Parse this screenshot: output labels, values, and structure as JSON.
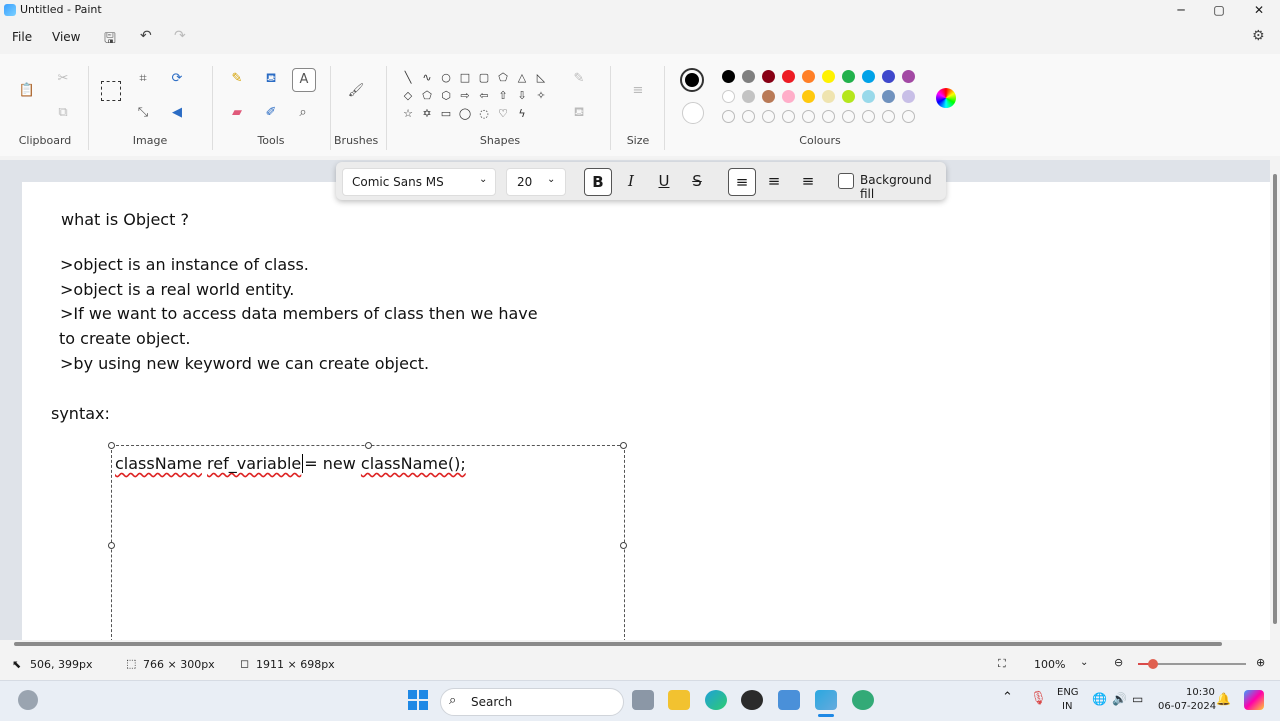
{
  "window": {
    "title": "Untitled - Paint",
    "min": "─",
    "max": "▢",
    "close": "✕"
  },
  "menu": {
    "file": "File",
    "view": "View"
  },
  "ribbon": {
    "groups": {
      "clipboard": "Clipboard",
      "image": "Image",
      "tools": "Tools",
      "brushes": "Brushes",
      "shapes": "Shapes",
      "size": "Size",
      "colours": "Colours"
    }
  },
  "colors": {
    "row1": [
      "#000000",
      "#7f7f7f",
      "#880015",
      "#ed1c24",
      "#ff7f27",
      "#fff200",
      "#22b14c",
      "#00a2e8",
      "#3f48cc",
      "#a349a4"
    ],
    "row2": [
      "#ffffff",
      "#c3c3c3",
      "#b97a57",
      "#ffaec9",
      "#ffc90e",
      "#efe4b0",
      "#b5e61d",
      "#99d9ea",
      "#7092be",
      "#c8bfe7"
    ],
    "primary": "#000000",
    "secondary": "#ffffff"
  },
  "text_toolbar": {
    "font": "Comic Sans MS",
    "size": "20",
    "bold": "B",
    "italic": "I",
    "underline": "U",
    "strike": "S",
    "background_fill": "Background fill"
  },
  "canvas": {
    "heading": "what is Object ?",
    "lines": [
      ">object is an instance of class.",
      ">object is a real world entity.",
      ">If we want to access data members of class then we have",
      "to create object.",
      ">by using new keyword we can create object."
    ],
    "syntax_label": "syntax:",
    "code": {
      "p1": "className",
      "p2": "ref_variable",
      "p3": "= new",
      "p4": "className();"
    }
  },
  "status": {
    "cursor": "506, 399px",
    "selection": "766 × 300px",
    "canvas_size": "1911 × 698px",
    "zoom": "100%"
  },
  "taskbar": {
    "search": "Search",
    "lang1": "ENG",
    "lang2": "IN",
    "time": "10:30",
    "date": "06-07-2024"
  }
}
